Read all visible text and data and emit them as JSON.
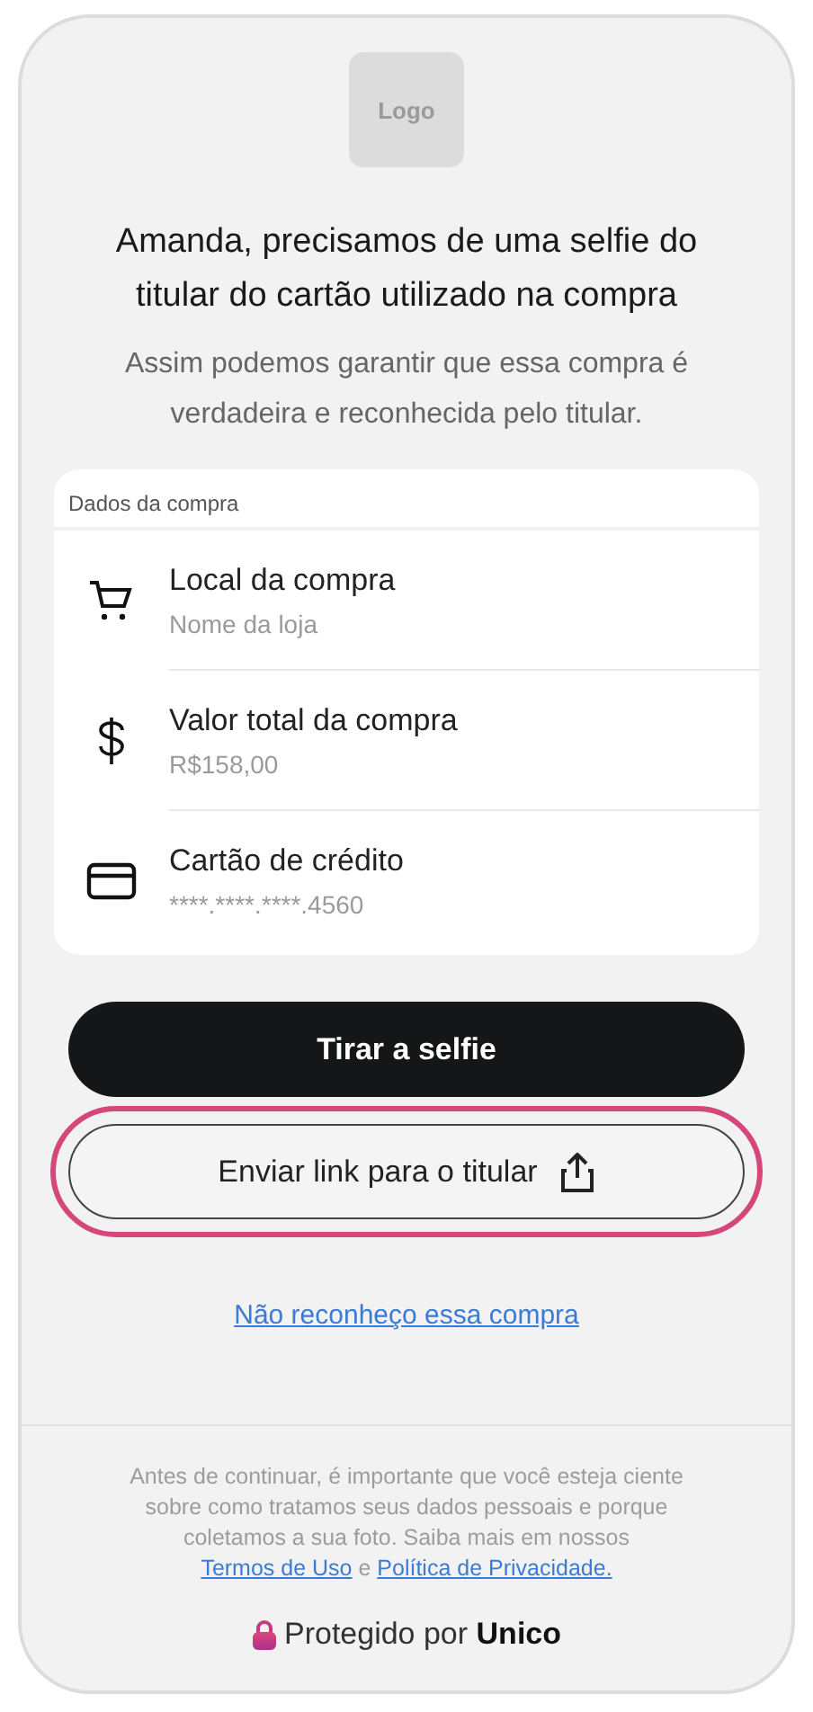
{
  "logo": "Logo",
  "title": "Amanda, precisamos de uma selfie do titular do cartão utilizado na compra",
  "subtitle": "Assim podemos garantir que essa compra é verdadeira e reconhecida pelo titular.",
  "purchase_card": {
    "heading": "Dados da compra",
    "rows": [
      {
        "kind": "cart",
        "label": "Local da compra",
        "value": "Nome da loja"
      },
      {
        "kind": "dollar",
        "label": "Valor total da compra",
        "value": "R$158,00"
      },
      {
        "kind": "card",
        "label": "Cartão de crédito",
        "value": "****.****.****.4560"
      }
    ]
  },
  "buttons": [
    {
      "kind": "primary",
      "label": "Tirar a selfie",
      "highlighted": false
    },
    {
      "kind": "share",
      "label": "Enviar link para o titular",
      "highlighted": true
    }
  ],
  "deny_link": "Não reconheço essa compra",
  "disclaimer": {
    "text": "Antes de continuar, é importante que você esteja ciente sobre como tratamos seus dados pessoais e porque coletamos a sua foto. Saiba mais em nossos",
    "terms_link": "Termos de Uso",
    "connector": "e",
    "privacy_link": "Política de Privacidade."
  },
  "footer": "Protegido por **Unico**"
}
